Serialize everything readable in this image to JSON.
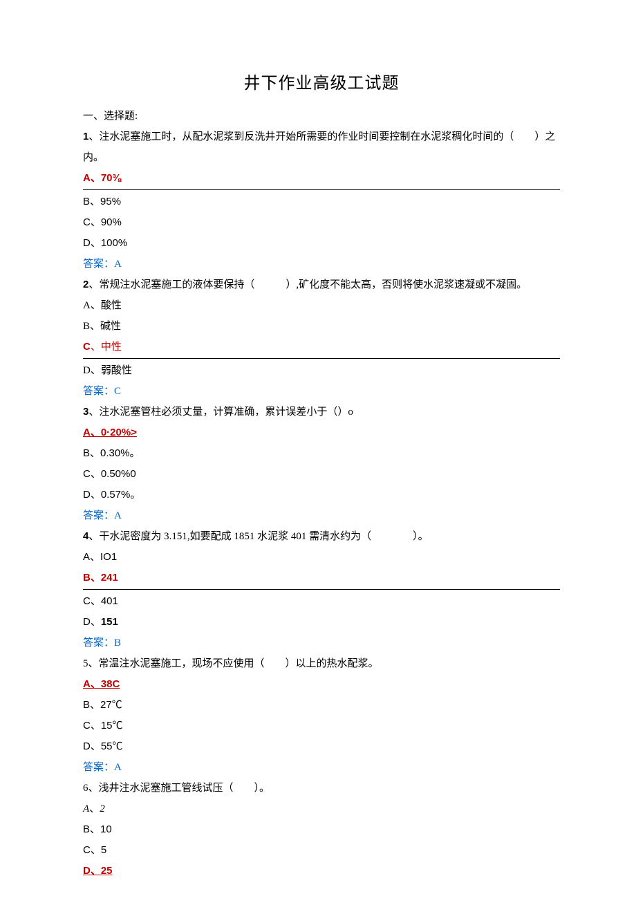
{
  "title": "井下作业高级工试题",
  "section_heading": "一、选择题:",
  "questions": [
    {
      "stem_parts": [
        {
          "text": "1",
          "cls": "arial bold"
        },
        {
          "text": "、注水泥塞施工时，从配水泥浆到反洗井开始所需要的作业时间要控制在水泥浆稠化时间的（　　）之内。",
          "cls": ""
        }
      ],
      "options": [
        {
          "label": "A、70⅜",
          "cls": "arial red bold",
          "row_underline": true
        },
        {
          "label": "B、95%",
          "cls": "arial"
        },
        {
          "label": "C、90%",
          "cls": "arial"
        },
        {
          "label": "D、100%",
          "cls": "arial"
        }
      ],
      "answer": "答案：A"
    },
    {
      "stem_parts": [
        {
          "text": "2",
          "cls": "arial bold"
        },
        {
          "text": "、常规注水泥塞施工的液体要保持（　　　）,矿化度不能太高，否则将使水泥浆速凝或不凝固。",
          "cls": ""
        }
      ],
      "options": [
        {
          "label": "A、酸性",
          "cls": ""
        },
        {
          "label": "B、碱性",
          "cls": ""
        },
        {
          "label_parts": [
            {
              "text": "C",
              "cls": "arial red bold"
            },
            {
              "text": "、中性",
              "cls": "red"
            }
          ],
          "row_underline": true
        },
        {
          "label": "D、弱酸性",
          "cls": ""
        }
      ],
      "answer": "答案：C"
    },
    {
      "stem_parts": [
        {
          "text": "3",
          "cls": "arial bold"
        },
        {
          "text": "、注水泥塞管柱必须丈量，计算准确，累计误差小于（）o",
          "cls": ""
        }
      ],
      "options": [
        {
          "label": "A、0·20%>",
          "cls": "arial red bold underline-text"
        },
        {
          "label": "B、0.30%。",
          "cls": "arial"
        },
        {
          "label": "C、0.50%0",
          "cls": "arial"
        },
        {
          "label": "D、0.57%。",
          "cls": "arial"
        }
      ],
      "answer": "答案：A"
    },
    {
      "stem_parts": [
        {
          "text": "4",
          "cls": "arial bold"
        },
        {
          "text": "、干水泥密度为 3.151,如要配成 1851 水泥浆 401 需清水约为（　　　　）。",
          "cls": ""
        }
      ],
      "options": [
        {
          "label": "A、IO1",
          "cls": "arial"
        },
        {
          "label": "B、241",
          "cls": "arial red bold",
          "row_underline": true
        },
        {
          "label": "C、401",
          "cls": "arial"
        },
        {
          "label_parts": [
            {
              "text": "D、",
              "cls": "arial"
            },
            {
              "text": "151",
              "cls": "arial bold"
            }
          ]
        }
      ],
      "answer": "答案：B"
    },
    {
      "stem_parts": [
        {
          "text": "5、常温注水泥塞施工，现场不应使用（　　）以上的热水配浆。",
          "cls": ""
        }
      ],
      "options": [
        {
          "label": "A、38C",
          "cls": "arial red bold underline-text"
        },
        {
          "label": "B、27℃",
          "cls": "arial"
        },
        {
          "label": "C、15℃",
          "cls": "arial"
        },
        {
          "label": "D、55℃",
          "cls": "arial"
        }
      ],
      "answer": "答案：A"
    },
    {
      "stem_parts": [
        {
          "text": "6、浅井注水泥塞施工管线试压（　　）。",
          "cls": ""
        }
      ],
      "options": [
        {
          "label_parts": [
            {
              "text": "A",
              "cls": "italic"
            },
            {
              "text": "、",
              "cls": ""
            },
            {
              "text": "2",
              "cls": "italic"
            }
          ]
        },
        {
          "label": "B、10",
          "cls": "arial"
        },
        {
          "label": "C、5",
          "cls": "arial"
        },
        {
          "label": "D、25",
          "cls": "arial red bold underline-text"
        }
      ],
      "answer": ""
    }
  ]
}
